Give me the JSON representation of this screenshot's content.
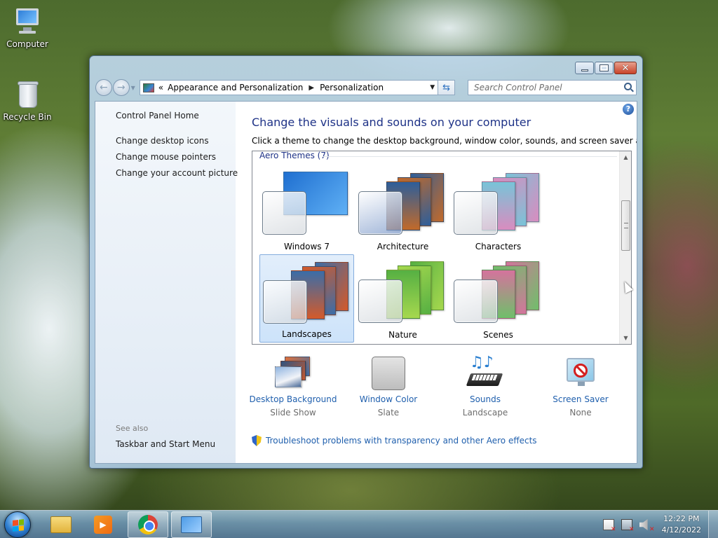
{
  "desktop": {
    "icons": [
      {
        "label": "Computer",
        "icon": "computer-icon"
      },
      {
        "label": "Recycle Bin",
        "icon": "recycle-bin-icon"
      }
    ]
  },
  "window": {
    "address": {
      "icon": "control-panel-icon",
      "crumb_prefix": "«",
      "crumbs": [
        "Appearance and Personalization",
        "Personalization"
      ]
    },
    "search": {
      "placeholder": "Search Control Panel"
    },
    "sidebar": {
      "home": "Control Panel Home",
      "links": [
        "Change desktop icons",
        "Change mouse pointers",
        "Change your account picture"
      ],
      "see_also_label": "See also",
      "see_also_links": [
        "Taskbar and Start Menu"
      ]
    },
    "main": {
      "title": "Change the visuals and sounds on your computer",
      "description": "Click a theme to change the desktop background, window color, sounds, and screen saver all at once.",
      "group_label": "Aero Themes (7)",
      "themes": [
        {
          "name": "Windows 7",
          "selected": false,
          "colors": [
            "#1f6fd0",
            "#5fb0f5"
          ]
        },
        {
          "name": "Architecture",
          "selected": false,
          "colors": [
            "#2d5e9a",
            "#c26a2a"
          ]
        },
        {
          "name": "Characters",
          "selected": false,
          "colors": [
            "#78c4d8",
            "#d98cbf"
          ]
        },
        {
          "name": "Landscapes",
          "selected": true,
          "colors": [
            "#3a6da8",
            "#d45a2a"
          ]
        },
        {
          "name": "Nature",
          "selected": false,
          "colors": [
            "#56b043",
            "#a6d84e"
          ]
        },
        {
          "name": "Scenes",
          "selected": false,
          "colors": [
            "#d5739d",
            "#6fbf6a"
          ]
        }
      ],
      "settings": [
        {
          "label": "Desktop Background",
          "value": "Slide Show",
          "icon": "desktop-background-icon"
        },
        {
          "label": "Window Color",
          "value": "Slate",
          "icon": "window-color-icon"
        },
        {
          "label": "Sounds",
          "value": "Landscape",
          "icon": "sounds-icon"
        },
        {
          "label": "Screen Saver",
          "value": "None",
          "icon": "screen-saver-icon"
        }
      ],
      "troubleshoot": "Troubleshoot problems with transparency and other Aero effects"
    }
  },
  "taskbar": {
    "apps": [
      "windows-explorer-icon",
      "media-player-icon",
      "chrome-icon",
      "control-panel-icon"
    ],
    "time": "12:22 PM",
    "date": "4/12/2022"
  }
}
